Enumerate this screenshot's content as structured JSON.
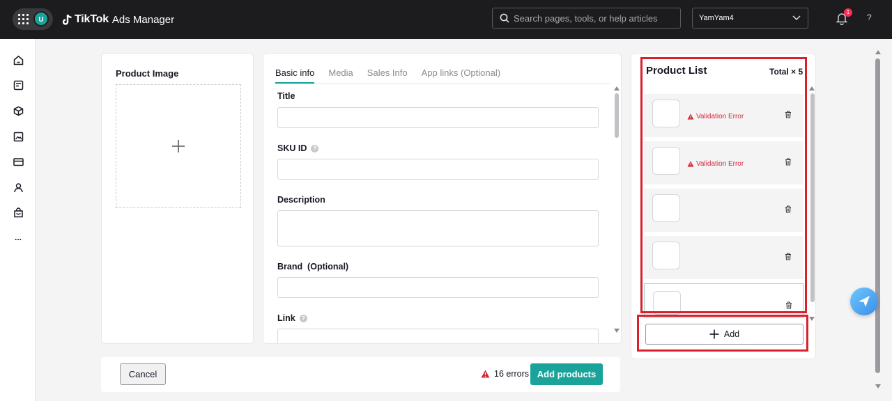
{
  "header": {
    "avatar_initial": "U",
    "logo_brand": "TikTok",
    "logo_product": "Ads Manager",
    "search_placeholder": "Search pages, tools, or help articles",
    "account_name": "YamYam4",
    "notification_count": "1",
    "help_label": "?"
  },
  "sidebar": {
    "items": [
      "home-icon",
      "campaign-icon",
      "package-icon",
      "assets-icon",
      "payment-icon",
      "user-icon",
      "shop-icon",
      "more-icon"
    ],
    "more_label": "..."
  },
  "image_panel": {
    "title": "Product Image"
  },
  "form": {
    "tabs": [
      {
        "label": "Basic info",
        "active": true
      },
      {
        "label": "Media",
        "active": false
      },
      {
        "label": "Sales Info",
        "active": false
      },
      {
        "label": "App links (Optional)",
        "active": false
      }
    ],
    "fields": {
      "title": {
        "label": "Title",
        "value": ""
      },
      "sku": {
        "label": "SKU ID",
        "value": ""
      },
      "description": {
        "label": "Description",
        "value": ""
      },
      "brand": {
        "label": "Brand  (Optional)",
        "value": ""
      },
      "link": {
        "label": "Link",
        "value": ""
      }
    },
    "info_glyph": "?"
  },
  "footer": {
    "cancel_label": "Cancel",
    "errors_label": "16 errors",
    "add_products_label": "Add products"
  },
  "product_list": {
    "title": "Product List",
    "total_label": "Total × 5",
    "items": [
      {
        "error": "Validation Error"
      },
      {
        "error": "Validation Error"
      },
      {
        "error": ""
      },
      {
        "error": ""
      },
      {
        "error": "",
        "selected": true
      }
    ],
    "add_label": "Add"
  },
  "colors": {
    "accent": "#1aa39a",
    "error": "#d3293b",
    "highlight": "#d9202c",
    "topbar": "#1c1c1e"
  }
}
